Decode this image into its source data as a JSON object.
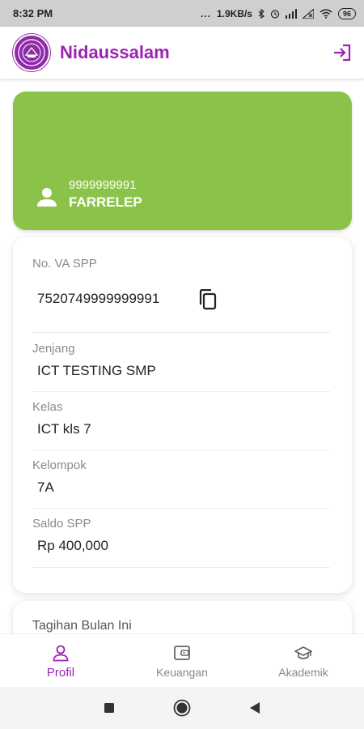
{
  "status_bar": {
    "time": "8:32 PM",
    "dots": "...",
    "speed": "1.9KB/s",
    "battery": "96"
  },
  "app": {
    "title": "Nidaussalam",
    "logo_color": "#8e2aa8",
    "accent": "#9b23b5"
  },
  "student": {
    "id": "9999999991",
    "name": "FARRELEP",
    "card_color": "#8bc34a"
  },
  "info": {
    "va_label": "No. VA SPP",
    "va_value": "7520749999999991",
    "jenjang_label": "Jenjang",
    "jenjang_value": "ICT TESTING SMP",
    "kelas_label": "Kelas",
    "kelas_value": "ICT kls 7",
    "kelompok_label": "Kelompok",
    "kelompok_value": "7A",
    "saldo_label": "Saldo SPP",
    "saldo_value": "Rp 400,000"
  },
  "next_card": {
    "title": "Tagihan Bulan Ini"
  },
  "bottom_nav": {
    "items": [
      {
        "label": "Profil",
        "icon": "person-icon"
      },
      {
        "label": "Keuangan",
        "icon": "wallet-icon"
      },
      {
        "label": "Akademik",
        "icon": "graduation-cap-icon"
      }
    ]
  }
}
